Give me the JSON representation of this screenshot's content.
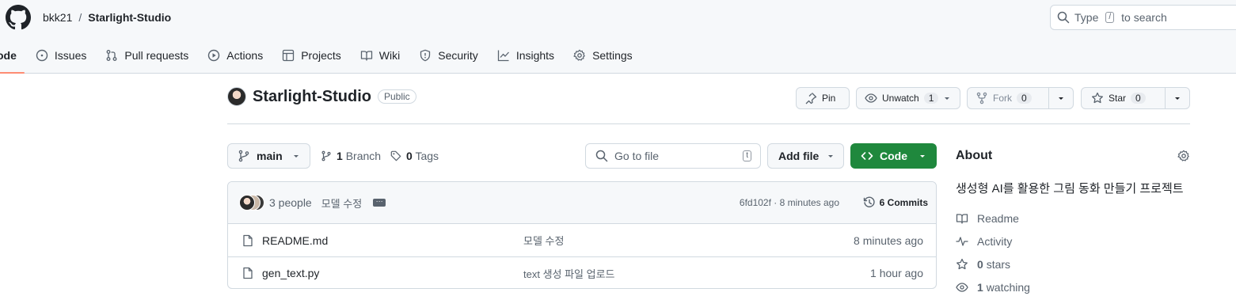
{
  "header": {
    "owner": "bkk21",
    "separator": "/",
    "repo": "Starlight-Studio",
    "search_prefix": "Type",
    "search_key": "/",
    "search_suffix": "to search"
  },
  "nav": {
    "code": "ode",
    "issues": "Issues",
    "pulls": "Pull requests",
    "actions": "Actions",
    "projects": "Projects",
    "wiki": "Wiki",
    "security": "Security",
    "insights": "Insights",
    "settings": "Settings"
  },
  "repo": {
    "name": "Starlight-Studio",
    "visibility": "Public",
    "pin": "Pin",
    "unwatch": "Unwatch",
    "watch_count": "1",
    "fork": "Fork",
    "fork_count": "0",
    "star": "Star",
    "star_count": "0"
  },
  "toolbar": {
    "branch": "main",
    "branch_count": "1",
    "branch_label": "Branch",
    "tag_count": "0",
    "tag_label": "Tags",
    "goto_placeholder": "Go to file",
    "goto_key": "t",
    "add_file": "Add file",
    "code": "Code"
  },
  "latest_commit": {
    "people": "3 people",
    "message": "모델 수정",
    "ellipsis": "···",
    "sha_age": "6fd102f · 8 minutes ago",
    "commits": "6 Commits"
  },
  "files": [
    {
      "name": "README.md",
      "message": "모델 수정",
      "age": "8 minutes ago"
    },
    {
      "name": "gen_text.py",
      "message": "text 생성 파일 업로드",
      "age": "1 hour ago"
    }
  ],
  "about": {
    "title": "About",
    "description": "생성형 AI를 활용한 그림 동화 만들기 프로젝트",
    "readme": "Readme",
    "activity": "Activity",
    "stars_count": "0",
    "stars_label": "stars",
    "watching_count": "1",
    "watching_label": "watching"
  },
  "colors": {
    "accent_green": "#1f883d",
    "nav_underline": "#fd8c73",
    "border": "#d1d9e0",
    "muted_text": "#59636e"
  }
}
